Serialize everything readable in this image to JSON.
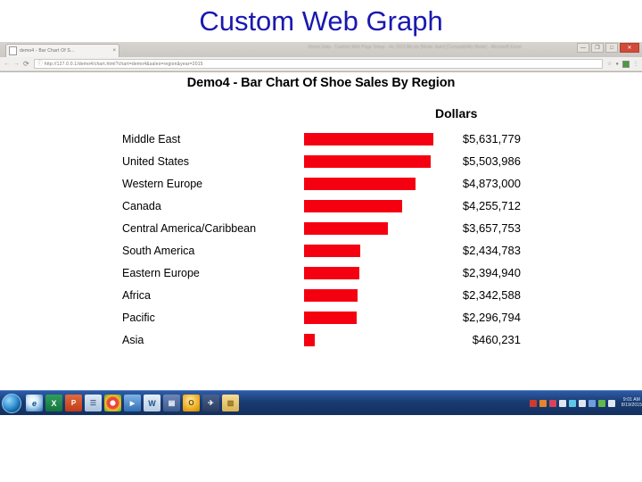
{
  "slide": {
    "title": "Custom Web Graph",
    "title_color": "#1a18b0"
  },
  "browser": {
    "tab_title": "demo4 - Bar Chart Of S...",
    "tab_close_glyph": "×",
    "window_title": "Demo Data - Custom Web Page Setup - xls 2013 file.xls [Mode: Auto] [Compatibility Mode] - Microsoft Excel",
    "back_glyph": "←",
    "forward_glyph": "→",
    "reload_glyph": "⟳",
    "omnibox_info_glyph": "ⓘ",
    "url": "http://127.0.0.1/demo4/chart.html?chart=demo4&sales=region&year=2015",
    "star_glyph": "☆",
    "ext_glyph": "●",
    "menu_glyph": "⋮",
    "minimize_glyph": "—",
    "restore_glyph": "❐",
    "maximize_glyph": "□",
    "close_glyph": "✕"
  },
  "chart_data": {
    "type": "bar",
    "orientation": "horizontal",
    "title": "Demo4 - Bar Chart Of Shoe Sales By Region",
    "value_column_header": "Dollars",
    "bar_color": "#f50011",
    "xlabel": "",
    "ylabel": "",
    "grid": false,
    "legend": "none",
    "xlim": [
      0,
      5631779
    ],
    "categories": [
      "Middle East",
      "United States",
      "Western Europe",
      "Canada",
      "Central America/Caribbean",
      "South America",
      "Eastern Europe",
      "Africa",
      "Pacific",
      "Asia"
    ],
    "values": [
      5631779,
      5503986,
      4873000,
      4255712,
      3657753,
      2434783,
      2394940,
      2342588,
      2296794,
      460231
    ],
    "value_labels": [
      "$5,631,779",
      "$5,503,986",
      "$4,873,000",
      "$4,255,712",
      "$3,657,753",
      "$2,434,783",
      "$2,394,940",
      "$2,342,588",
      "$2,296,794",
      "$460,231"
    ]
  },
  "taskbar": {
    "start_label": "",
    "apps": [
      {
        "name": "internet-explorer",
        "glyph": "e",
        "cls": "app-ie"
      },
      {
        "name": "excel",
        "glyph": "X",
        "cls": "app-excel"
      },
      {
        "name": "powerpoint",
        "glyph": "P",
        "cls": "app-ppt"
      },
      {
        "name": "notepad",
        "glyph": "☰",
        "cls": "app-note"
      },
      {
        "name": "chrome",
        "glyph": "●",
        "cls": "app-chrome"
      },
      {
        "name": "media-player",
        "glyph": "▶",
        "cls": "app-blue"
      },
      {
        "name": "word",
        "glyph": "W",
        "cls": "app-word"
      },
      {
        "name": "onenote",
        "glyph": "▤",
        "cls": "app-book"
      },
      {
        "name": "outlook",
        "glyph": "O",
        "cls": "app-amber"
      },
      {
        "name": "remote-desktop",
        "glyph": "✈",
        "cls": "app-plane"
      },
      {
        "name": "file-explorer",
        "glyph": "▧",
        "cls": "app-folder"
      }
    ],
    "tray_icons": [
      "ti-red",
      "ti-orange",
      "ti-rose",
      "ti-white",
      "ti-cyan",
      "ti-white",
      "ti-blue",
      "ti-green",
      "ti-white"
    ],
    "clock_time": "9:01 AM",
    "clock_date": "8/19/2015"
  }
}
